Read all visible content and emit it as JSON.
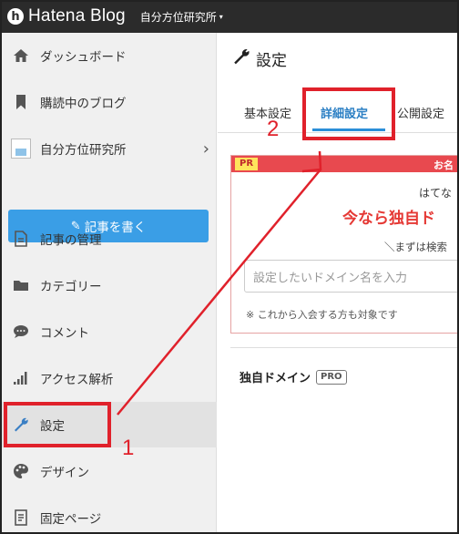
{
  "topbar": {
    "logo_mark": "h",
    "logo_text": "Hatena Blog",
    "blog_name": "自分方位研究所",
    "caret": "▾"
  },
  "sidebar": {
    "items": [
      {
        "label": "ダッシュボード",
        "icon": "home-icon"
      },
      {
        "label": "購読中のブログ",
        "icon": "bookmark-icon"
      },
      {
        "label": "自分方位研究所",
        "icon": "blog-thumbnail-icon"
      },
      {
        "label": "記事の管理",
        "icon": "document-icon"
      },
      {
        "label": "カテゴリー",
        "icon": "folder-icon"
      },
      {
        "label": "コメント",
        "icon": "comment-icon"
      },
      {
        "label": "アクセス解析",
        "icon": "bar-chart-icon"
      },
      {
        "label": "設定",
        "icon": "wrench-icon"
      },
      {
        "label": "デザイン",
        "icon": "palette-icon"
      },
      {
        "label": "固定ページ",
        "icon": "page-icon"
      }
    ],
    "write_button": "記事を書く",
    "active_item": "設定"
  },
  "main": {
    "title": "設定",
    "tabs": [
      {
        "label": "基本設定"
      },
      {
        "label": "詳細設定"
      },
      {
        "label": "公開設定"
      }
    ],
    "active_tab": "詳細設定",
    "pr": {
      "tag": "PR",
      "right_text": "お名",
      "line1": "はてな",
      "line2": "今なら独自ド",
      "line3": "＼まずは検索",
      "input_placeholder": "設定したいドメイン名を入力",
      "note": "※ これから入会する方も対象です"
    },
    "domain_label": "独自ドメイン",
    "pro_badge": "PRO"
  },
  "annotations": {
    "step1": "1",
    "step2": "2",
    "color": "#e0212b"
  },
  "colors": {
    "topbar": "#2b2b2b",
    "accent": "#3a9ee6",
    "pr_bar": "#e8494f",
    "pr_headline": "#e53935"
  }
}
